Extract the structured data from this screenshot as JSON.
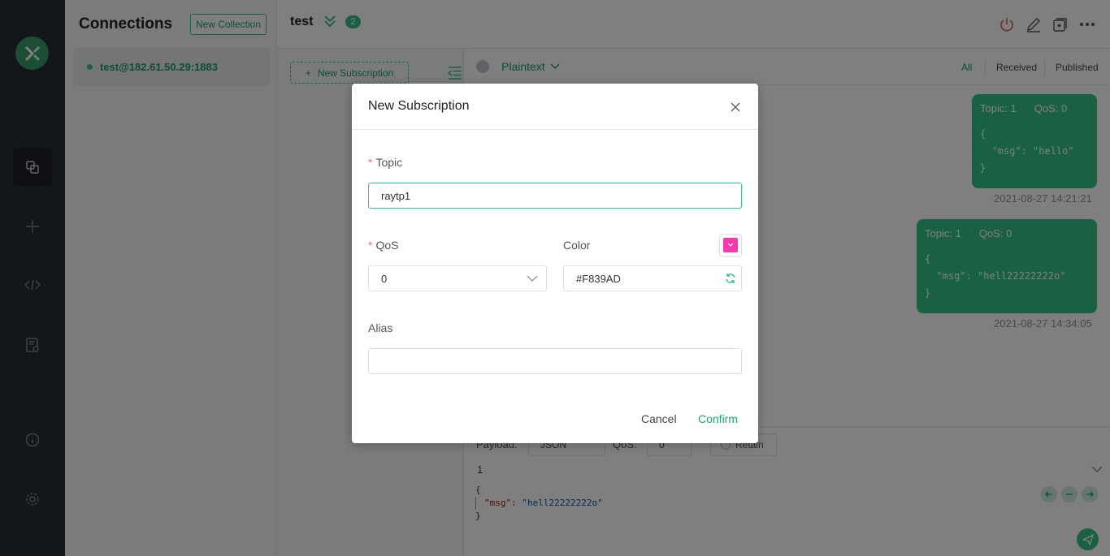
{
  "app": {
    "accent": "#34C388",
    "rail": {
      "logo": "mqttx-logo",
      "items": [
        "connections-icon",
        "plus-icon",
        "code-icon",
        "log-icon",
        "info-icon",
        "settings-icon"
      ]
    }
  },
  "connections": {
    "title": "Connections",
    "new_collection": "New Collection",
    "items": [
      {
        "label": "test@182.61.50.29:1883",
        "status": "connected"
      }
    ]
  },
  "header": {
    "name": "test",
    "badge": "2",
    "icons": [
      "power-icon",
      "edit-icon",
      "new-window-icon",
      "more-icon"
    ]
  },
  "subscriptions": {
    "new_button": "New Subscription"
  },
  "messages": {
    "format": "Plaintext",
    "filters": [
      "All",
      "Received",
      "Published"
    ],
    "items": [
      {
        "topic": "Topic: 1",
        "qos": "QoS: 0",
        "body": "{\n  \"msg\": \"hello\"\n}",
        "time": "2021-08-27 14:21:21"
      },
      {
        "topic": "Topic: 1",
        "qos": "QoS: 0",
        "body": "{\n  \"msg\": \"hell22222222o\"\n}",
        "time": "2021-08-27 14:34:05"
      }
    ]
  },
  "composer": {
    "payload_label": "Payload:",
    "payload_value": "JSON",
    "qos_label": "QoS:",
    "qos_value": "0",
    "retain_label": "Retain",
    "line_number": "1",
    "code_open": "{",
    "code_key": "\"msg\"",
    "code_colon": ": ",
    "code_value": "\"hell22222222o\"",
    "code_close": "}"
  },
  "dialog": {
    "title": "New Subscription",
    "topic_label": "Topic",
    "topic_value": "raytp1",
    "qos_label": "QoS",
    "qos_value": "0",
    "color_label": "Color",
    "color_value": "#F839AD",
    "alias_label": "Alias",
    "alias_value": "",
    "cancel": "Cancel",
    "confirm": "Confirm"
  }
}
